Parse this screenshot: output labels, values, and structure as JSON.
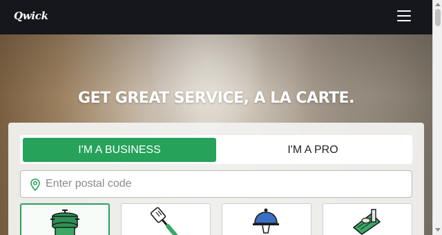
{
  "navbar": {
    "logo_text": "Qwick",
    "menu_icon": "hamburger-menu-icon"
  },
  "hero": {
    "title": "GET GREAT SERVICE, A LA CARTE."
  },
  "role_toggle": {
    "options": [
      {
        "label": "I'M A BUSINESS",
        "selected": true
      },
      {
        "label": "I'M A PRO",
        "selected": false
      }
    ]
  },
  "postal": {
    "placeholder": "Enter postal code",
    "value": "",
    "icon": "location-pin-icon"
  },
  "service_tiles": [
    {
      "icon": "cooking-pots-icon",
      "selected": true
    },
    {
      "icon": "spatula-icon",
      "selected": false
    },
    {
      "icon": "serving-cloche-icon",
      "selected": false
    },
    {
      "icon": "cutting-board-icon",
      "selected": false
    }
  ],
  "colors": {
    "accent": "#26a25a",
    "navbar": "#15171c",
    "text": "#222222"
  }
}
